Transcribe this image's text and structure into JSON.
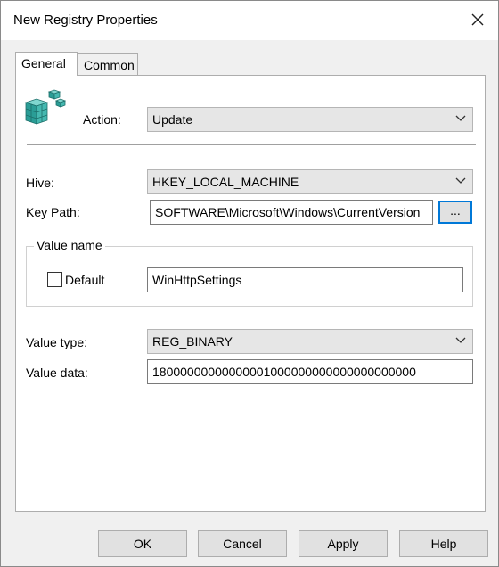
{
  "window": {
    "title": "New Registry Properties",
    "close_icon": "close-icon"
  },
  "tabs": [
    {
      "label": "General",
      "active": true
    },
    {
      "label": "Common",
      "active": false
    }
  ],
  "general": {
    "action_label": "Action:",
    "action_value": "Update",
    "hive_label": "Hive:",
    "hive_value": "HKEY_LOCAL_MACHINE",
    "keypath_label": "Key Path:",
    "keypath_value": "SOFTWARE\\Microsoft\\Windows\\CurrentVersion",
    "browse_label": "...",
    "value_name_group": "Value name",
    "default_label": "Default",
    "default_checked": false,
    "value_name_value": "WinHttpSettings",
    "value_type_label": "Value type:",
    "value_type_value": "REG_BINARY",
    "value_data_label": "Value data:",
    "value_data_value": "18000000000000001000000000000000000000"
  },
  "buttons": {
    "ok": "OK",
    "cancel": "Cancel",
    "apply": "Apply",
    "help": "Help"
  },
  "colors": {
    "dialog_bg": "#f0f0f0",
    "accent": "#0078d7"
  }
}
